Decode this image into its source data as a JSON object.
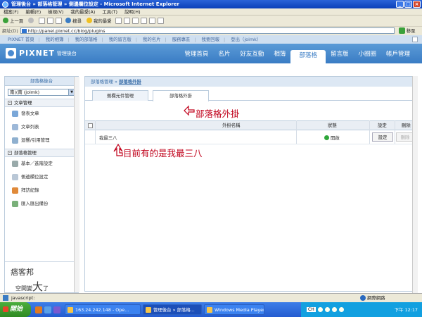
{
  "window": {
    "title": "管理後台 » 部落格管理 » 側邊欄位設定 - Microsoft Internet Explorer"
  },
  "menu": [
    "檔案(F)",
    "編輯(E)",
    "檢視(V)",
    "我的最愛(A)",
    "工具(T)",
    "說明(H)"
  ],
  "toolbar": {
    "back": "上一頁",
    "search": "搜尋",
    "favorites": "我的最愛"
  },
  "address": {
    "label": "網址(D)",
    "url": "http://panel.pixnet.cc/blog/plugins",
    "go": "移至"
  },
  "topnav": [
    "PIXNET 首頁",
    "我的相簿",
    "我的部落格",
    "我的留言版",
    "我的名片",
    "服務專區",
    "我要回報",
    "登出（joimk）"
  ],
  "header": {
    "brand": "PIXNET",
    "subtitle": "管理後台"
  },
  "mainnav": [
    "管理首頁",
    "名片",
    "好友互動",
    "相簿",
    "部落格",
    "留言版",
    "小圈圈",
    "帳戶管理"
  ],
  "sidebar": {
    "title": "部落格後台",
    "blog_select": "南)(南 (joimk)",
    "sections": [
      {
        "title": "文章管理",
        "items": [
          "發表文章",
          "文章列表",
          "迴響/引用管理"
        ]
      },
      {
        "title": "部落格管理",
        "items": [
          "基本／進階設定",
          "側邊欄位設定",
          "拜訪紀錄",
          "匯入匯出備份"
        ]
      }
    ],
    "promo": {
      "line1": "痞客邦",
      "line2": "空間變",
      "big": "大",
      "end": "了"
    }
  },
  "content": {
    "breadcrumb": {
      "parent": "部落格管理",
      "current": "部落格外掛"
    },
    "tabs": [
      "側欄元件管理",
      "部落格外掛"
    ],
    "table": {
      "headers": {
        "name": "外掛名稱",
        "status": "狀態",
        "settings": "設定",
        "delete": "刪除"
      },
      "rows": [
        {
          "name": "我最三八",
          "status": "開啟",
          "settings": "設定",
          "delete": "刪除"
        }
      ]
    }
  },
  "annotations": {
    "a1": "部落格外掛",
    "a2": "目前有的是我最三八"
  },
  "statusbar": {
    "left": "javascript:",
    "right": "網際網路"
  },
  "taskbar": {
    "start": "開始",
    "tasks": [
      "163.24.242.148 - Ope...",
      "管理後台 » 部落格...",
      "Windows Media Player"
    ],
    "lang": "CH",
    "clock": "下午 12:17"
  }
}
